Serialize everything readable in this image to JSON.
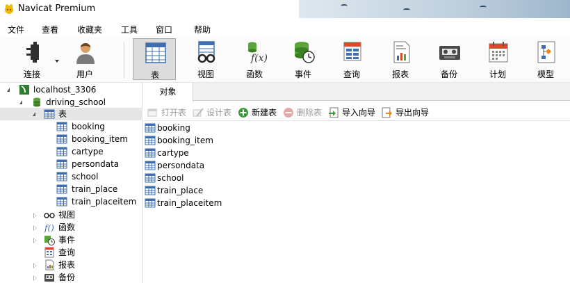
{
  "window": {
    "title": "Navicat Premium"
  },
  "menu": [
    "文件",
    "查看",
    "收藏夹",
    "工具",
    "窗口",
    "帮助"
  ],
  "toolbar": {
    "connect": "连接",
    "user": "用户",
    "table": "表",
    "view": "视图",
    "function": "函数",
    "event": "事件",
    "query": "查询",
    "report": "报表",
    "backup": "备份",
    "schedule": "计划",
    "model": "模型"
  },
  "tree": {
    "connection": "localhost_3306",
    "database": "driving_school",
    "tables_label": "表",
    "tables": [
      "booking",
      "booking_item",
      "cartype",
      "persondata",
      "school",
      "train_place",
      "train_placeitem"
    ],
    "views_label": "视图",
    "functions_label": "函数",
    "events_label": "事件",
    "queries_label": "查询",
    "reports_label": "报表",
    "backups_label": "备份"
  },
  "tab": {
    "objects": "对象"
  },
  "object_toolbar": {
    "open": "打开表",
    "design": "设计表",
    "new": "新建表",
    "delete": "删除表",
    "import": "导入向导",
    "export": "导出向导"
  },
  "objects": [
    "booking",
    "booking_item",
    "cartype",
    "persondata",
    "school",
    "train_place",
    "train_placeitem"
  ],
  "colors": {
    "accent": "#3a78c3",
    "selected": "#e6e6e6",
    "db_green": "#4caf50"
  }
}
